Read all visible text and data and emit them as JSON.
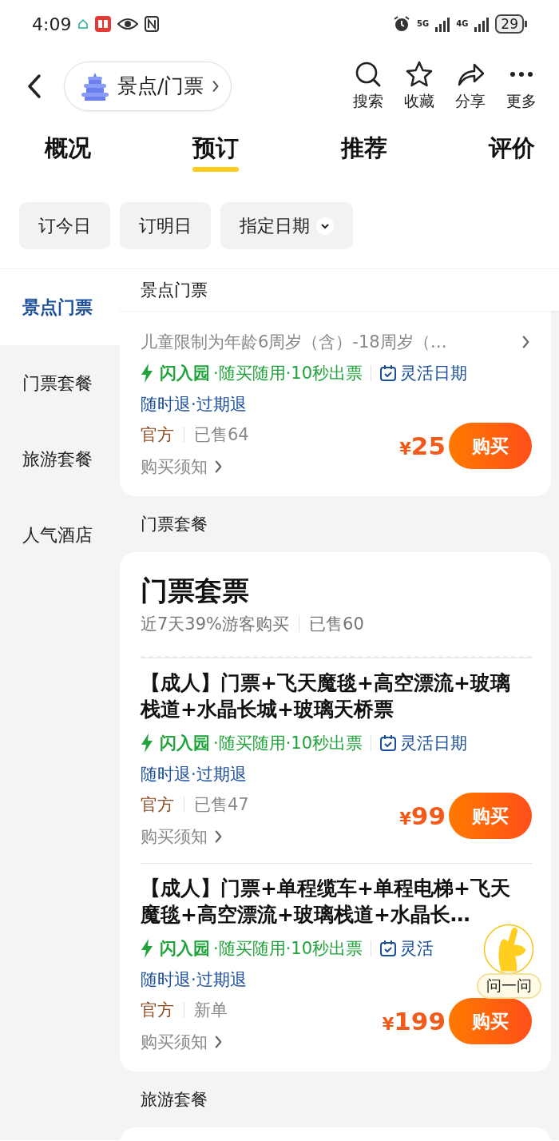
{
  "status_bar": {
    "time": "4:09",
    "network_1": "5G",
    "network_2": "4G",
    "battery": "29"
  },
  "header": {
    "location": "景点/门票",
    "actions": [
      {
        "label": "搜索"
      },
      {
        "label": "收藏"
      },
      {
        "label": "分享"
      },
      {
        "label": "更多"
      }
    ]
  },
  "tabs": [
    {
      "label": "概况",
      "selected": false
    },
    {
      "label": "预订",
      "selected": true
    },
    {
      "label": "推荐",
      "selected": false
    },
    {
      "label": "评价",
      "selected": false
    }
  ],
  "date_chips": [
    {
      "label": "订今日",
      "kind": "plain"
    },
    {
      "label": "订明日",
      "kind": "plain"
    },
    {
      "label": "指定日期",
      "kind": "dropdown"
    }
  ],
  "sidebar": {
    "items": [
      {
        "label": "景点门票",
        "selected": true
      },
      {
        "label": "门票套餐",
        "selected": false
      },
      {
        "label": "旅游套餐",
        "selected": false
      },
      {
        "label": "人气酒店",
        "selected": false
      }
    ]
  },
  "sticky_header": "景点门票",
  "groups": [
    {
      "products": [
        {
          "description": "儿童限制为年龄6周岁（含）-18周岁（…",
          "flash": "闪入园",
          "flash_detail": "·随买随用·10秒出票",
          "date_tag": "灵活日期",
          "refund": "随时退·过期退",
          "source": "官方",
          "sales": "已售64",
          "notice": "购买须知",
          "currency": "¥",
          "price": "25",
          "button": "购买"
        }
      ]
    },
    {
      "label": "门票套餐",
      "heading": "门票套票",
      "stats": [
        "近7天39%游客购买",
        "已售60"
      ],
      "products": [
        {
          "title": "【成人】门票+飞天魔毯+高空漂流+玻璃栈道+水晶长城+玻璃天桥票",
          "flash": "闪入园",
          "flash_detail": "·随买随用·10秒出票",
          "date_tag": "灵活日期",
          "refund": "随时退·过期退",
          "source": "官方",
          "sales": "已售47",
          "notice": "购买须知",
          "currency": "¥",
          "price": "99",
          "button": "购买"
        },
        {
          "title": "【成人】门票+单程缆车+单程电梯+飞天魔毯+高空漂流+玻璃栈道+水晶长…",
          "flash": "闪入园",
          "flash_detail": "·随买随用·10秒出票",
          "date_tag": "灵活",
          "refund": "随时退·过期退",
          "source": "官方",
          "sales": "新单",
          "notice": "购买须知",
          "currency": "¥",
          "price": "199",
          "button": "购买"
        }
      ]
    },
    {
      "label": "旅游套餐"
    }
  ],
  "assistant": {
    "label": "问一问"
  }
}
